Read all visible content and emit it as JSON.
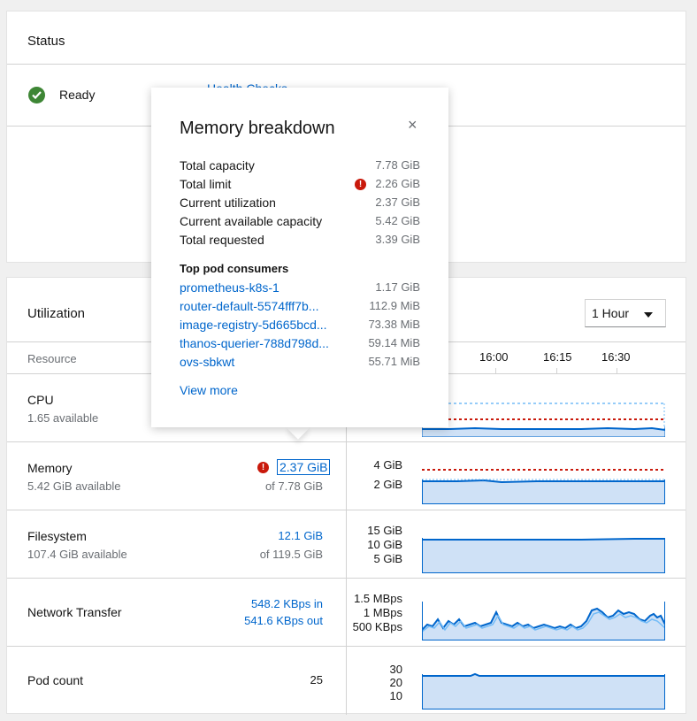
{
  "status": {
    "title": "Status",
    "ready_label": "Ready",
    "health_checks_link": "Health Checks"
  },
  "utilization": {
    "title": "Utilization",
    "time_range": "1 Hour",
    "resource_header": "Resource",
    "time_ticks": [
      "16:00",
      "16:15",
      "16:30"
    ],
    "rows": [
      {
        "name": "CPU",
        "sub": "1.65 available"
      },
      {
        "name": "Memory",
        "sub": "5.42 GiB available",
        "value": "2.37 GiB",
        "of": "of 7.78 GiB",
        "axis": [
          "4 GiB",
          "2 GiB"
        ]
      },
      {
        "name": "Filesystem",
        "sub": "107.4 GiB available",
        "value": "12.1 GiB",
        "of": "of 119.5 GiB",
        "axis": [
          "15 GiB",
          "10 GiB",
          "5 GiB"
        ]
      },
      {
        "name": "Network Transfer",
        "value_in": "548.2 KBps in",
        "value_out": "541.6 KBps out",
        "axis": [
          "1.5 MBps",
          "1 MBps",
          "500 KBps"
        ]
      },
      {
        "name": "Pod count",
        "value": "25",
        "axis": [
          "30",
          "20",
          "10"
        ]
      }
    ]
  },
  "popover": {
    "title": "Memory breakdown",
    "close_glyph": "×",
    "items": [
      {
        "label": "Total capacity",
        "value": "7.78 GiB"
      },
      {
        "label": "Total limit",
        "value": "2.26 GiB",
        "warning": true
      },
      {
        "label": "Current utilization",
        "value": "2.37 GiB"
      },
      {
        "label": "Current available capacity",
        "value": "5.42 GiB"
      },
      {
        "label": "Total requested",
        "value": "3.39 GiB"
      }
    ],
    "consumers_title": "Top pod consumers",
    "consumers": [
      {
        "name": "prometheus-k8s-1",
        "value": "1.17 GiB"
      },
      {
        "name": "router-default-5574fff7b...",
        "value": "112.9 MiB"
      },
      {
        "name": "image-registry-5d665bcd...",
        "value": "73.38 MiB"
      },
      {
        "name": "thanos-querier-788d798d...",
        "value": "59.14 MiB"
      },
      {
        "name": "ovs-sbkwt",
        "value": "55.71 MiB"
      }
    ],
    "view_more": "View more"
  },
  "colors": {
    "link": "#0066cc",
    "chart_line": "#0066cc",
    "chart_fill": "#cfe1f6",
    "limit_line": "#c9190b",
    "request_line": "#73bcf7",
    "ready_green": "#3e8635",
    "error_red": "#c9190b"
  },
  "icons": {
    "ready": "check-circle-icon",
    "warning": "exclamation-circle-icon",
    "close": "close-icon",
    "dropdown": "caret-down-icon"
  }
}
